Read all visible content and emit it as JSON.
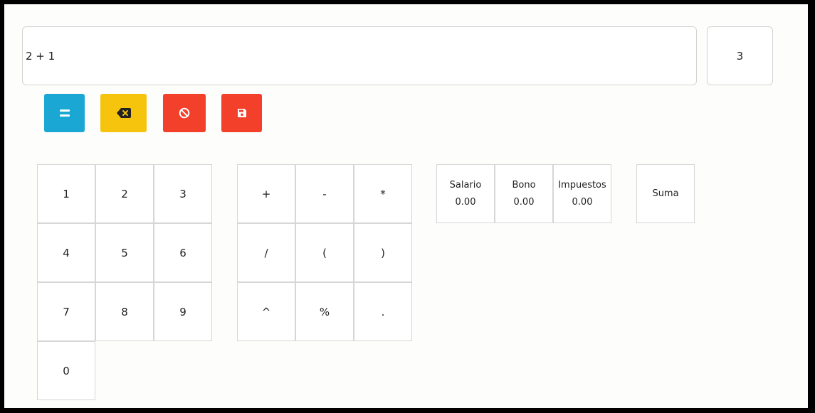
{
  "expression": {
    "value": "2 + 1"
  },
  "result": {
    "value": "3"
  },
  "actions": [
    {
      "name": "equals-button",
      "icon": "equals-icon",
      "color": "#1aa7d4"
    },
    {
      "name": "backspace-button",
      "icon": "backspace-icon",
      "color": "#f6c40c"
    },
    {
      "name": "clear-button",
      "icon": "ban-icon",
      "color": "#f2402b"
    },
    {
      "name": "save-button",
      "icon": "floppy-disk-icon",
      "color": "#f2402b"
    }
  ],
  "digits": [
    "1",
    "2",
    "3",
    "4",
    "5",
    "6",
    "7",
    "8",
    "9",
    "0"
  ],
  "operators": [
    "+",
    "-",
    "*",
    "/",
    "(",
    ")",
    "^",
    "%",
    "."
  ],
  "variables": [
    {
      "label": "Salario",
      "value": "0.00"
    },
    {
      "label": "Bono",
      "value": "0.00"
    },
    {
      "label": "Impuestos",
      "value": "0.00"
    }
  ],
  "functions": {
    "sum_label": "Suma"
  }
}
